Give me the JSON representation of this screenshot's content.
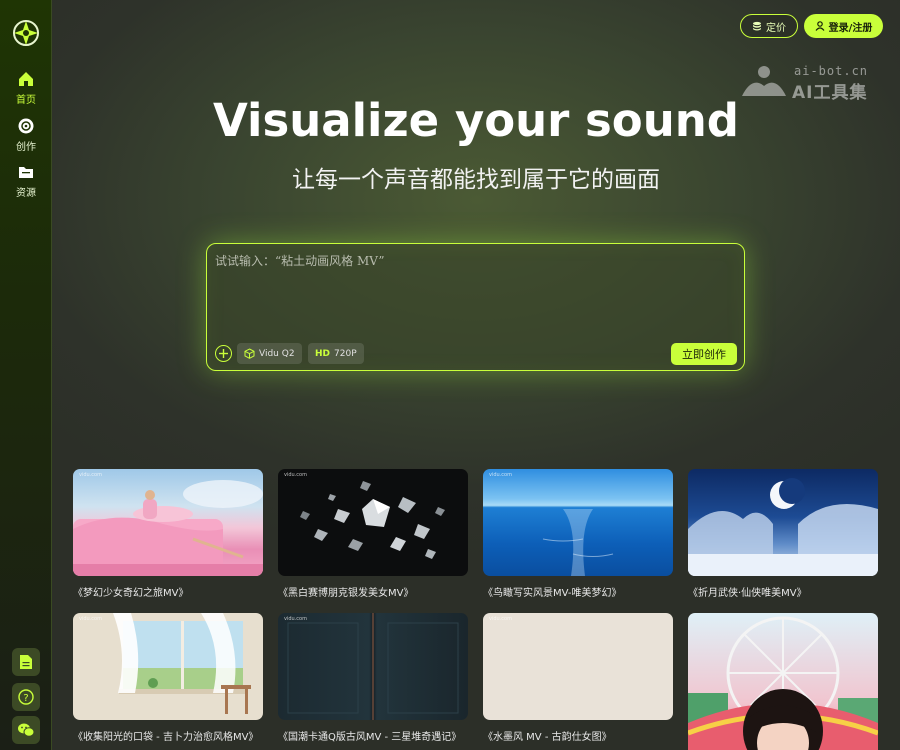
{
  "sidebar": {
    "items": [
      {
        "label": "首页",
        "icon": "home-icon",
        "active": true
      },
      {
        "label": "创作",
        "icon": "disc-icon",
        "active": false
      },
      {
        "label": "资源",
        "icon": "folder-icon",
        "active": false
      }
    ],
    "bottom_icons": [
      "document-icon",
      "help-icon",
      "wechat-icon"
    ]
  },
  "header": {
    "pricing_label": "定价",
    "login_label": "登录/注册"
  },
  "watermark": {
    "line1": "ai-bot.cn",
    "line2": "AI工具集"
  },
  "hero": {
    "title": "Visualize your sound",
    "subtitle": "让每一个声音都能找到属于它的画面"
  },
  "prompt": {
    "placeholder": "试试输入：“粘土动画风格 MV”",
    "model_label": "Vidu Q2",
    "resolution_prefix": "HD",
    "resolution_label": "720P",
    "submit_label": "立即创作"
  },
  "gallery": [
    {
      "title": "《梦幻少女奇幻之旅MV》",
      "thumb": "pink-bed",
      "tag": "vidu.com"
    },
    {
      "title": "《黑白赛博朋克银发美女MV》",
      "thumb": "crystals",
      "tag": "vidu.com"
    },
    {
      "title": "《鸟瞰写实风景MV-唯美梦幻》",
      "thumb": "ocean",
      "tag": "vidu.com"
    },
    {
      "title": "《折月武侠·仙侠唯美MV》",
      "thumb": "snow-moon",
      "tag": ""
    },
    {
      "title": "《收集阳光的口袋 - 吉卜力治愈风格MV》",
      "thumb": "window",
      "tag": "vidu.com"
    },
    {
      "title": "《国潮卡通Q版古风MV - 三星堆奇遇记》",
      "thumb": "dark-door",
      "tag": "vidu.com"
    },
    {
      "title": "《水墨风 MV - 古韵仕女图》",
      "thumb": "paper",
      "tag": "vidu.com"
    },
    {
      "title": "",
      "thumb": "ferris-girl",
      "tag": ""
    }
  ],
  "colors": {
    "accent": "#c9ff3a",
    "background": "#2d3126"
  }
}
